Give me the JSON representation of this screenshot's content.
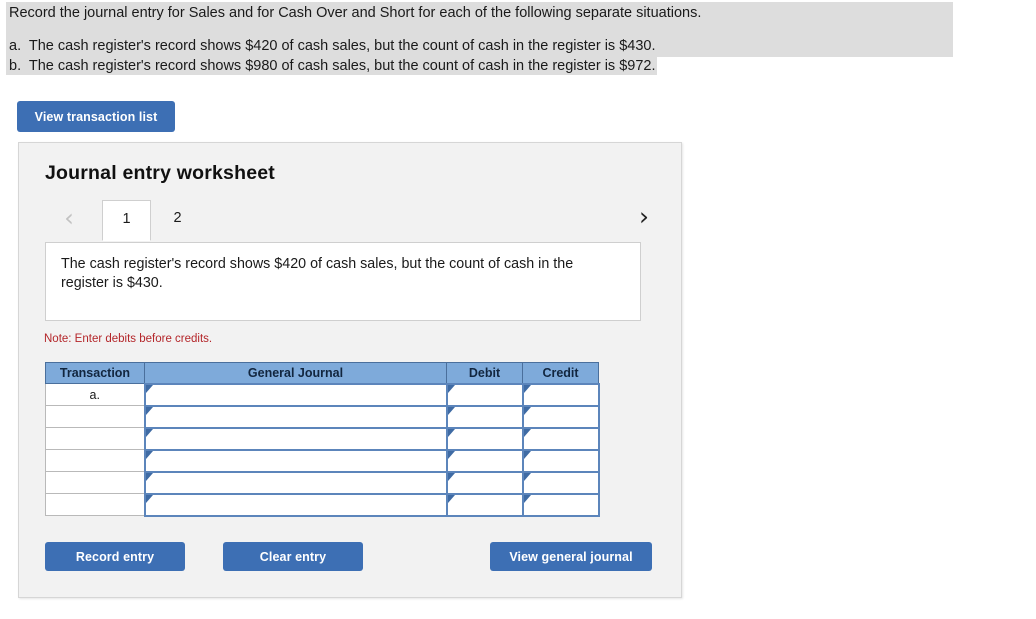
{
  "problem": {
    "prompt": "Record the journal entry for Sales and for Cash Over and Short for each of the following separate situations.",
    "situations": [
      "a.  The cash register's record shows $420 of cash sales, but the count of cash in the register is $430.",
      "b.  The cash register's record shows $980 of cash sales, but the count of cash in the register is $972."
    ]
  },
  "toolbar": {
    "view_transaction_list_label": "View transaction list"
  },
  "worksheet": {
    "title": "Journal entry worksheet",
    "prev_arrow_glyph": "‹",
    "next_arrow_glyph": "›",
    "tabs": [
      {
        "label": "1",
        "active": true
      },
      {
        "label": "2",
        "active": false
      }
    ],
    "description": "The cash register's record shows $420 of cash sales, but the count of cash in the register is $430.",
    "note": "Note: Enter debits before credits.",
    "table": {
      "headers": [
        "Transaction",
        "General Journal",
        "Debit",
        "Credit"
      ],
      "rows": [
        {
          "transaction": "a.",
          "general_journal": "",
          "debit": "",
          "credit": ""
        },
        {
          "transaction": "",
          "general_journal": "",
          "debit": "",
          "credit": ""
        },
        {
          "transaction": "",
          "general_journal": "",
          "debit": "",
          "credit": ""
        },
        {
          "transaction": "",
          "general_journal": "",
          "debit": "",
          "credit": ""
        },
        {
          "transaction": "",
          "general_journal": "",
          "debit": "",
          "credit": ""
        },
        {
          "transaction": "",
          "general_journal": "",
          "debit": "",
          "credit": ""
        }
      ]
    },
    "buttons": {
      "record_entry_label": "Record entry",
      "clear_entry_label": "Clear entry",
      "view_general_journal_label": "View general journal"
    }
  },
  "colors": {
    "button_blue": "#3d6fb4",
    "table_header_blue": "#7eaada",
    "cell_border_blue": "#5c85bb",
    "note_red": "#b4262a",
    "highlight_gray": "#dddddd",
    "panel_gray": "#f2f2f2"
  }
}
